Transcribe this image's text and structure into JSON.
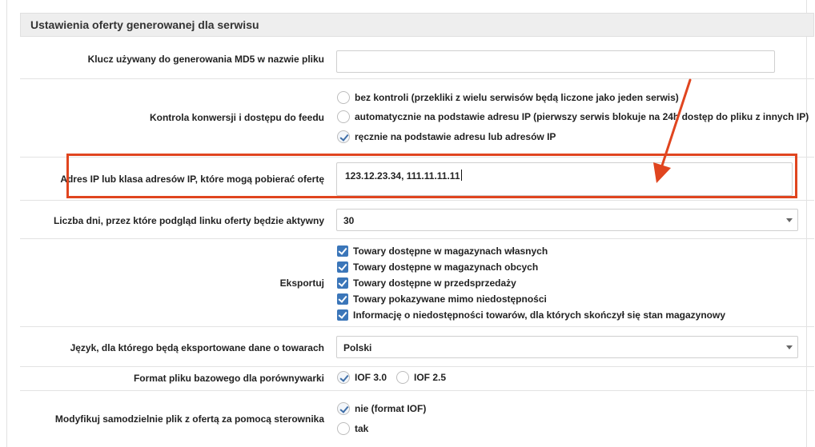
{
  "section": {
    "title": "Ustawienia oferty generowanej dla serwisu"
  },
  "md5": {
    "label": "Klucz używany do generowania MD5 w nazwie pliku",
    "value": ""
  },
  "conversion": {
    "label": "Kontrola konwersji i dostępu do feedu",
    "options": [
      {
        "label": "bez kontroli (przekliki z wielu serwisów będą liczone jako jeden serwis)",
        "checked": false
      },
      {
        "label": "automatycznie na podstawie adresu IP (pierwszy serwis blokuje na 24h dostęp do pliku z innych IP)",
        "checked": false
      },
      {
        "label": "ręcznie na podstawie adresu lub adresów IP",
        "checked": true
      }
    ]
  },
  "ip": {
    "label": "Adres IP lub klasa adresów IP, które mogą pobierać ofertę",
    "value": "123.12.23.34, 111.11.11.11"
  },
  "days": {
    "label": "Liczba dni, przez które podgląd linku oferty będzie aktywny",
    "value": "30"
  },
  "export": {
    "label": "Eksportuj",
    "options": [
      {
        "label": "Towary dostępne w magazynach własnych",
        "checked": true
      },
      {
        "label": "Towary dostępne w magazynach obcych",
        "checked": true
      },
      {
        "label": "Towary dostępne w przedsprzedaży",
        "checked": true
      },
      {
        "label": "Towary pokazywane mimo niedostępności",
        "checked": true
      },
      {
        "label": "Informację o niedostępności towarów, dla których skończył się stan magazynowy",
        "checked": true
      }
    ]
  },
  "language": {
    "label": "Język, dla którego będą eksportowane dane o towarach",
    "value": "Polski"
  },
  "format": {
    "label": "Format pliku bazowego dla porównywarki",
    "options": [
      {
        "label": "IOF 3.0",
        "checked": true
      },
      {
        "label": "IOF 2.5",
        "checked": false
      }
    ]
  },
  "modify": {
    "label": "Modyfikuj samodzielnie plik z ofertą za pomocą sterownika",
    "options": [
      {
        "label": "nie (format IOF)",
        "checked": true
      },
      {
        "label": "tak",
        "checked": false
      }
    ]
  },
  "colors": {
    "highlight": "#e0451f",
    "checkbox": "#3b76b9",
    "header_bg": "#eeeeee"
  }
}
